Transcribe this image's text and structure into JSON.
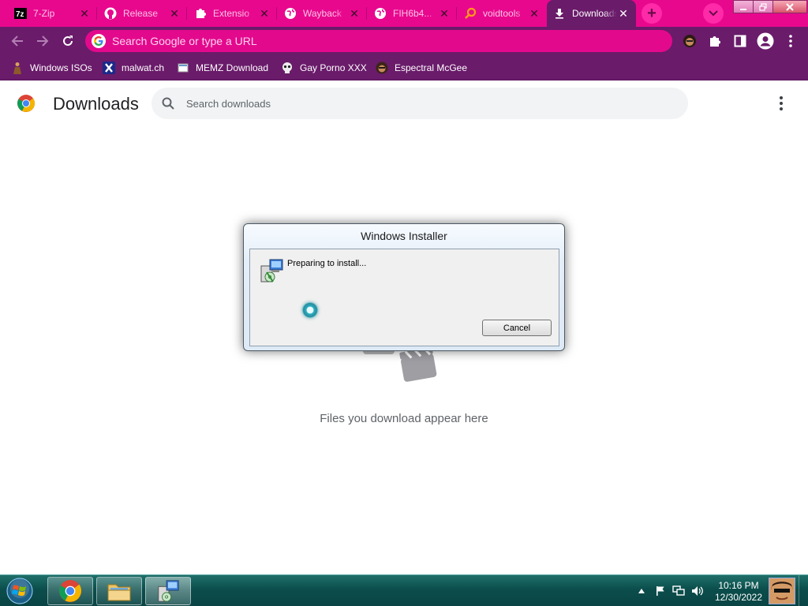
{
  "tabs": [
    {
      "title": "7-Zip",
      "icon": "7zip-icon"
    },
    {
      "title": "Release",
      "icon": "github-icon"
    },
    {
      "title": "Extensio",
      "icon": "puzzle-icon"
    },
    {
      "title": "Wayback",
      "icon": "globe-icon"
    },
    {
      "title": "FIH6b4...",
      "icon": "globe-icon"
    },
    {
      "title": "voidtools",
      "icon": "search-magnifier-icon"
    },
    {
      "title": "Downloads",
      "icon": "download-icon",
      "active": true
    }
  ],
  "omnibox": {
    "placeholder": "Search Google or type a URL"
  },
  "bookmarks": [
    {
      "label": "Windows ISOs",
      "icon": "figure-icon"
    },
    {
      "label": "malwat.ch",
      "icon": "x-logo-icon"
    },
    {
      "label": "MEMZ Download",
      "icon": "page-icon"
    },
    {
      "label": "Gay Porno XXX",
      "icon": "skull-icon"
    },
    {
      "label": "Espectral McGee",
      "icon": "avatar-icon"
    }
  ],
  "downloads": {
    "title": "Downloads",
    "search_placeholder": "Search downloads",
    "empty_message": "Files you download appear here"
  },
  "dialog": {
    "title": "Windows Installer",
    "message": "Preparing to install...",
    "cancel_label": "Cancel"
  },
  "taskbar": {
    "time": "10:16 PM",
    "date": "12/30/2022"
  },
  "colors": {
    "tabstrip": "#e8088e",
    "toolbar": "#6a1b6a",
    "omnibox": "#e3098d",
    "taskbar": "#0b4e4c"
  }
}
